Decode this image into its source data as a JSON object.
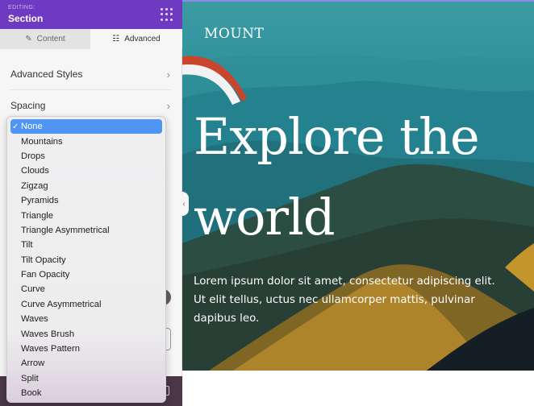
{
  "panel": {
    "editing_label": "EDITING:",
    "title": "Section",
    "menu_icon": "grip-dots-icon",
    "tabs": [
      {
        "label": "Content",
        "icon": "pencil-icon",
        "active": false
      },
      {
        "label": "Advanced",
        "icon": "sliders-icon",
        "active": true
      }
    ],
    "rows": [
      {
        "label": "Advanced Styles",
        "icon": "chevron-right-icon"
      },
      {
        "label": "Spacing",
        "icon": "chevron-right-icon"
      }
    ],
    "collapse_icon": "‹"
  },
  "dropdown": {
    "selected": "None",
    "check_glyph": "✓",
    "options": [
      "None",
      "Mountains",
      "Drops",
      "Clouds",
      "Zigzag",
      "Pyramids",
      "Triangle",
      "Triangle Asymmetrical",
      "Tilt",
      "Tilt Opacity",
      "Fan Opacity",
      "Curve",
      "Curve Asymmetrical",
      "Waves",
      "Waves Brush",
      "Waves Pattern",
      "Arrow",
      "Split",
      "Book"
    ]
  },
  "hero": {
    "brand": "MOUNT",
    "title": "Explore the\nworld",
    "text": "Lorem ipsum dolor sit amet, consectetur adipiscing elit. Ut elit tellus, uctus nec ullamcorper mattis, pulvinar dapibus leo."
  },
  "icons": {
    "pencil": "✎",
    "sliders": "☷",
    "chevron": "›"
  },
  "colors": {
    "header": "#6e3ac2",
    "selected": "#4e95f4",
    "footer": "#4b3747"
  }
}
